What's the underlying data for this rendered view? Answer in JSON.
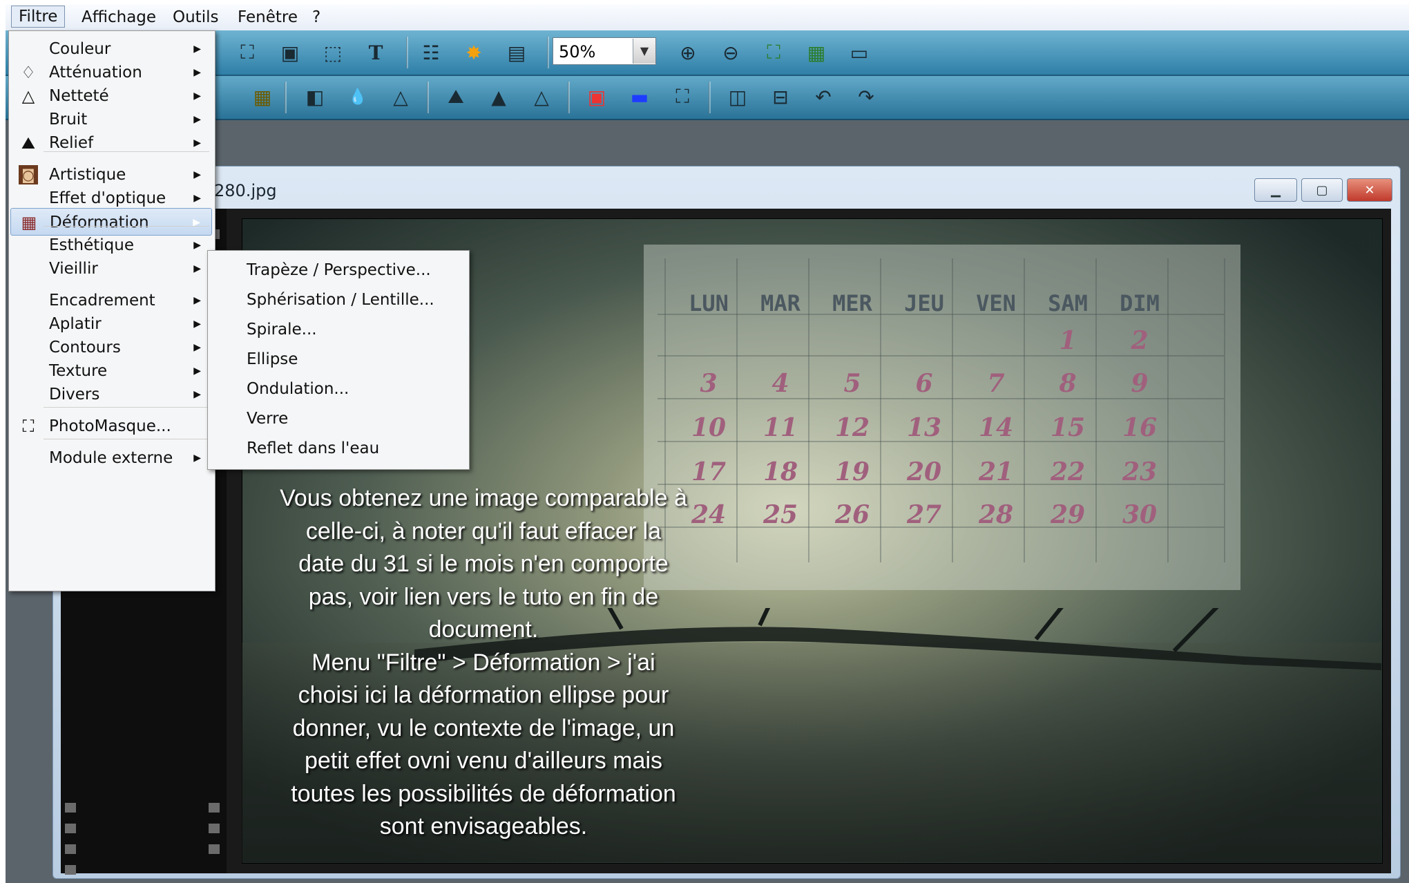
{
  "menubar": {
    "items": [
      "Filtre",
      "Affichage",
      "Outils",
      "Fenêtre",
      "?"
    ]
  },
  "toolbar": {
    "zoom_value": "50%"
  },
  "document": {
    "title_fragment": "280.jpg"
  },
  "filtre_menu": {
    "items": [
      {
        "label": "Couleur",
        "icon": "none",
        "submenu": true
      },
      {
        "label": "Atténuation",
        "icon": "droplet-icon",
        "submenu": true
      },
      {
        "label": "Netteté",
        "icon": "sharpen-triangle-icon",
        "submenu": true
      },
      {
        "label": "Bruit",
        "icon": "none",
        "submenu": true
      },
      {
        "label": "Relief",
        "icon": "relief-icon",
        "submenu": true
      },
      {
        "label": "Artistique",
        "icon": "portrait-icon",
        "submenu": true
      },
      {
        "label": "Effet d'optique",
        "icon": "none",
        "submenu": true
      },
      {
        "label": "Déformation",
        "icon": "grid-deform-icon",
        "submenu": true,
        "highlighted": true
      },
      {
        "label": "Esthétique",
        "icon": "none",
        "submenu": true
      },
      {
        "label": "Vieillir",
        "icon": "none",
        "submenu": true
      },
      {
        "label": "Encadrement",
        "icon": "none",
        "submenu": true
      },
      {
        "label": "Aplatir",
        "icon": "none",
        "submenu": true
      },
      {
        "label": "Contours",
        "icon": "none",
        "submenu": true
      },
      {
        "label": "Texture",
        "icon": "none",
        "submenu": true
      },
      {
        "label": "Divers",
        "icon": "none",
        "submenu": true
      },
      {
        "label": "PhotoMasque...",
        "icon": "photomask-icon",
        "submenu": false
      },
      {
        "label": "Module externe",
        "icon": "none",
        "submenu": true
      }
    ]
  },
  "deformation_submenu": {
    "items": [
      "Trapèze / Perspective...",
      "Sphérisation / Lentille...",
      "Spirale...",
      "Ellipse",
      "Ondulation...",
      "Verre",
      "Reflet dans l'eau"
    ]
  },
  "calendar": {
    "headers": [
      "LUN",
      "MAR",
      "MER",
      "JEU",
      "VEN",
      "SAM",
      "DIM"
    ],
    "rows": [
      [
        "",
        "",
        "",
        "",
        "",
        "1",
        "2"
      ],
      [
        "3",
        "4",
        "5",
        "6",
        "7",
        "8",
        "9"
      ],
      [
        "10",
        "11",
        "12",
        "13",
        "14",
        "15",
        "16"
      ],
      [
        "17",
        "18",
        "19",
        "20",
        "21",
        "22",
        "23"
      ],
      [
        "24",
        "25",
        "26",
        "27",
        "28",
        "29",
        "30"
      ]
    ]
  },
  "overlay": {
    "lines": [
      "Vous obtenez une image comparable à",
      "celle-ci, à noter qu'il faut effacer la",
      "date du 31 si le mois n'en comporte",
      "pas, voir lien vers le tuto en fin de",
      "document.",
      "Menu \"Filtre\" > Déformation > j'ai",
      "choisi ici la déformation ellipse pour",
      "donner, vu le contexte de l'image, un",
      "petit effet ovni venu d'ailleurs mais",
      "toutes les possibilités de déformation",
      "sont envisageables."
    ]
  },
  "colors": {
    "toolbar": "#3a8bb3",
    "menu_highlight": "#c5d9f1",
    "calendar_digits": "#a0607d"
  }
}
